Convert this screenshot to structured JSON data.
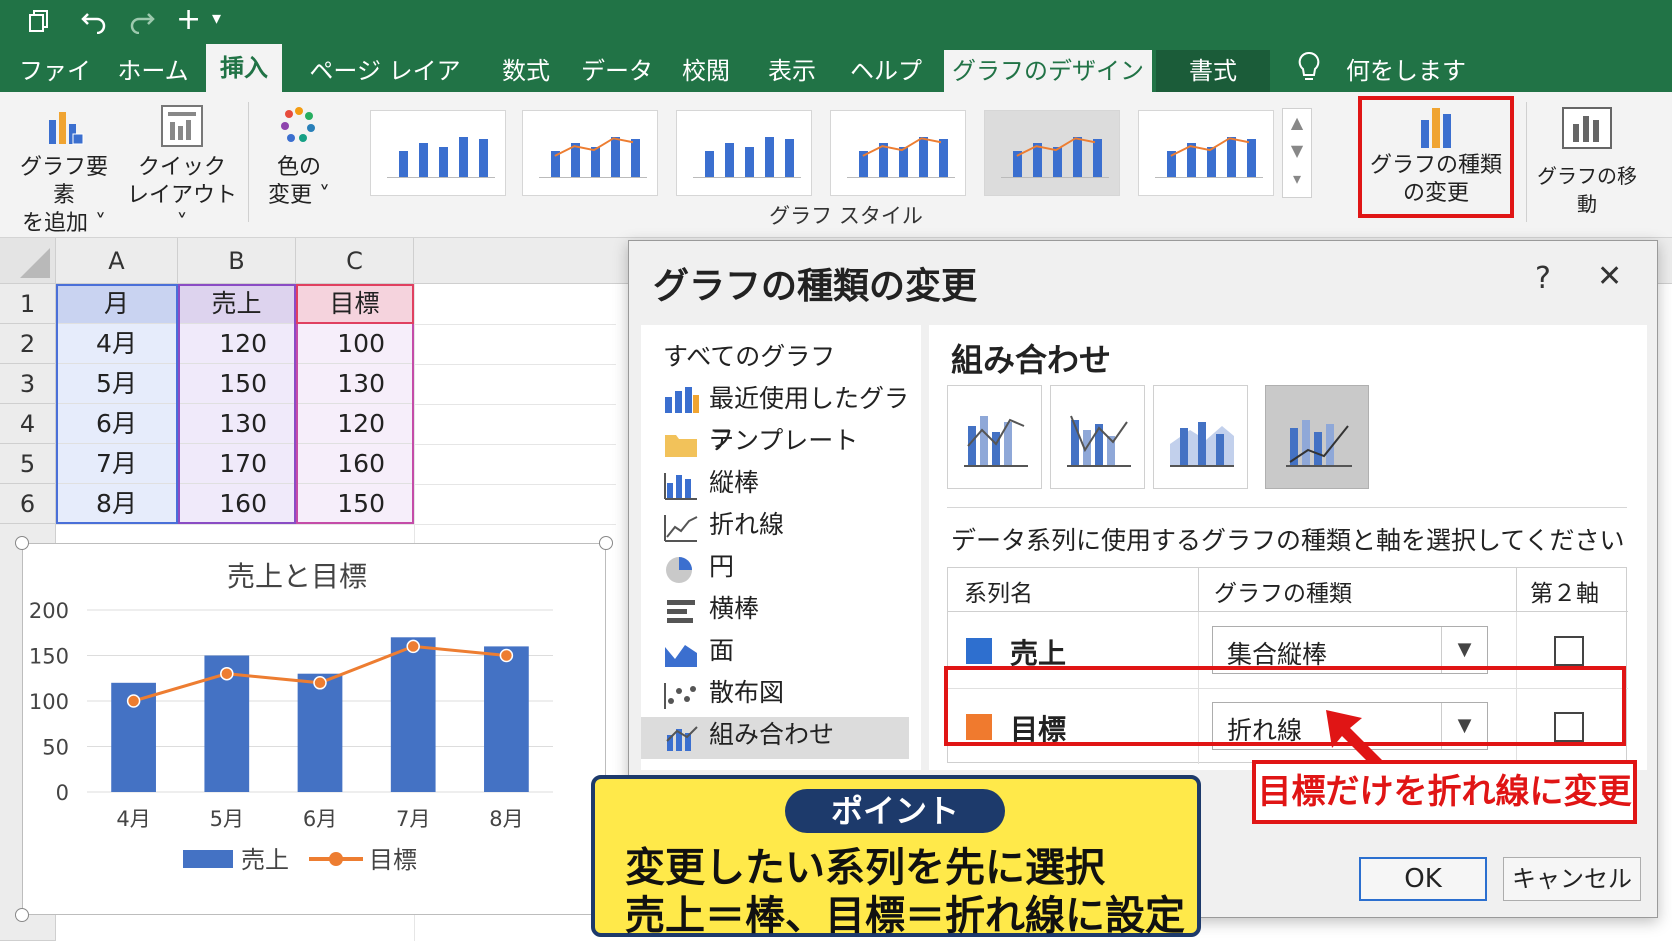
{
  "qat": {
    "undo_icon": "undo-icon",
    "redo_icon": "redo-icon",
    "add_icon": "+",
    "dropdown_icon": "▾"
  },
  "tabs": [
    {
      "label": "ファイル"
    },
    {
      "label": "ホーム"
    },
    {
      "label": "挿入"
    },
    {
      "label": "ページ レイアウト"
    },
    {
      "label": "数式"
    },
    {
      "label": "データ"
    },
    {
      "label": "校閲"
    },
    {
      "label": "表示"
    },
    {
      "label": "ヘルプ"
    },
    {
      "label": "グラフのデザイン"
    },
    {
      "label": "書式"
    }
  ],
  "tellme": "何をしますか",
  "ribbon": {
    "add_element_line1": "グラフ要素",
    "add_element_line2": "を追加 ˅",
    "quick_layout_line1": "クイック",
    "quick_layout_line2": "レイアウト˅",
    "colors_line1": "色の",
    "colors_line2": "変更 ˅",
    "group_label": "グラフ スタイル",
    "change_type_line1": "グラフの種類",
    "change_type_line2": "の変更",
    "move_chart": "グラフの移動",
    "accent_red": "#e01515"
  },
  "sheet": {
    "columns": [
      "A",
      "B",
      "C"
    ],
    "rows": [
      "1",
      "2",
      "3",
      "4",
      "5",
      "6"
    ],
    "header": [
      "月",
      "売上",
      "目標"
    ],
    "data": [
      [
        "4月",
        "120",
        "100"
      ],
      [
        "5月",
        "150",
        "130"
      ],
      [
        "6月",
        "130",
        "120"
      ],
      [
        "7月",
        "170",
        "160"
      ],
      [
        "8月",
        "160",
        "150"
      ]
    ]
  },
  "chart_data": {
    "type": "bar",
    "title": "売上と目標",
    "categories": [
      "4月",
      "5月",
      "6月",
      "7月",
      "8月"
    ],
    "series": [
      {
        "name": "売上",
        "type": "bar",
        "values": [
          120,
          150,
          130,
          170,
          160
        ],
        "color": "#4472c4"
      },
      {
        "name": "目標",
        "type": "line",
        "values": [
          100,
          130,
          120,
          160,
          150
        ],
        "color": "#ed7d31"
      }
    ],
    "ylim": [
      0,
      200
    ],
    "yticks": [
      "0",
      "50",
      "100",
      "150",
      "200"
    ],
    "grid": true,
    "legend": "bottom"
  },
  "dialog": {
    "title": "グラフの種類の変更",
    "help": "?",
    "close": "✕",
    "all_charts": "すべてのグラフ",
    "categories": [
      "最近使用したグラフ",
      "テンプレート",
      "縦棒",
      "折れ線",
      "円",
      "横棒",
      "面",
      "散布図",
      "組み合わせ"
    ],
    "combo_title": "組み合わせ",
    "instruction": "データ系列に使用するグラフの種類と軸を選択してください",
    "table_headers": [
      "系列名",
      "グラフの種類",
      "第２軸"
    ],
    "series_rows": [
      {
        "name": "売上",
        "chart_type": "集合縦棒",
        "color": "#2e6fcf"
      },
      {
        "name": "目標",
        "chart_type": "折れ線",
        "color": "#f07a2e"
      }
    ],
    "ok": "OK",
    "cancel": "キャンセル"
  },
  "callouts": {
    "point_label": "ポイント",
    "point_line1": "変更したい系列を先に選択",
    "point_line2": "売上＝棒、目標＝折れ線に設定",
    "red_note": "目標だけを折れ線に変更"
  }
}
